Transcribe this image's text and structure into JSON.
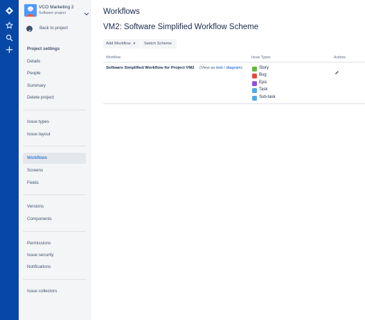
{
  "global_nav": {
    "icons": [
      "jira-logo-icon",
      "star-icon",
      "search-icon",
      "plus-icon"
    ]
  },
  "sidebar": {
    "project_name": "VCO Marketing 2",
    "project_type": "Software project",
    "back_label": "Back to project",
    "heading": "Project settings",
    "groups": [
      [
        "Details",
        "People",
        "Summary",
        "Delete project"
      ],
      [
        "Issue types",
        "Issue layout"
      ],
      [
        "Workflows",
        "Screens",
        "Fields"
      ],
      [
        "Versions",
        "Components"
      ],
      [
        "Permissions",
        "Issue security",
        "Notifications"
      ],
      [
        "Issue collectors"
      ]
    ],
    "selected_item": "Workflows"
  },
  "main": {
    "page_title": "Workflows",
    "scheme_title": "VM2: Software Simplified Workflow Scheme",
    "buttons": {
      "add_workflow": "Add Workflow",
      "switch_scheme": "Switch Scheme"
    },
    "table": {
      "headers": {
        "workflow": "Workflow",
        "issue_types": "Issue Types",
        "actions": "Actions"
      },
      "row": {
        "workflow_name": "Software Simplified Workflow for Project VM2",
        "view_prefix": "(View as ",
        "view_text_link": "text",
        "view_sep": " / ",
        "view_diagram_link": "diagram",
        "view_suffix": ")",
        "issue_types": [
          {
            "label": "Story",
            "color": "#63BA3C",
            "icon": "story-icon"
          },
          {
            "label": "Bug",
            "color": "#E5493A",
            "icon": "bug-icon"
          },
          {
            "label": "Epic",
            "color": "#904EE2",
            "icon": "epic-icon"
          },
          {
            "label": "Task",
            "color": "#4BADE8",
            "icon": "task-icon"
          },
          {
            "label": "Sub-task",
            "color": "#4BADE8",
            "icon": "subtask-icon"
          }
        ]
      }
    }
  },
  "colors": {
    "global_nav": "#0747A6",
    "link": "#0052CC",
    "sidebar_bg": "#F4F5F7"
  }
}
